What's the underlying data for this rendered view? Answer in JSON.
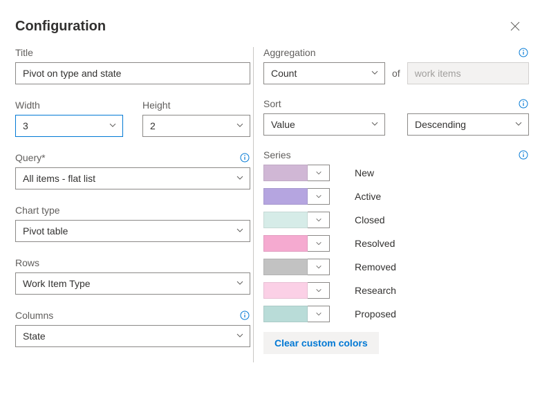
{
  "header": {
    "title": "Configuration"
  },
  "left": {
    "title_label": "Title",
    "title_value": "Pivot on type and state",
    "width_label": "Width",
    "width_value": "3",
    "height_label": "Height",
    "height_value": "2",
    "query_label": "Query*",
    "query_value": "All items - flat list",
    "chart_type_label": "Chart type",
    "chart_type_value": "Pivot table",
    "rows_label": "Rows",
    "rows_value": "Work Item Type",
    "columns_label": "Columns",
    "columns_value": "State"
  },
  "right": {
    "aggregation_label": "Aggregation",
    "aggregation_value": "Count",
    "aggregation_of": "of",
    "aggregation_target": "work items",
    "sort_label": "Sort",
    "sort_by_value": "Value",
    "sort_dir_value": "Descending",
    "series_label": "Series",
    "series": [
      {
        "label": "New",
        "color": "#d0b7d5"
      },
      {
        "label": "Active",
        "color": "#b5a5e0"
      },
      {
        "label": "Closed",
        "color": "#d6ece8"
      },
      {
        "label": "Resolved",
        "color": "#f5aad0"
      },
      {
        "label": "Removed",
        "color": "#c2c2c2"
      },
      {
        "label": "Research",
        "color": "#fbd0e6"
      },
      {
        "label": "Proposed",
        "color": "#b9dcd8"
      }
    ],
    "clear_colors_label": "Clear custom colors"
  }
}
